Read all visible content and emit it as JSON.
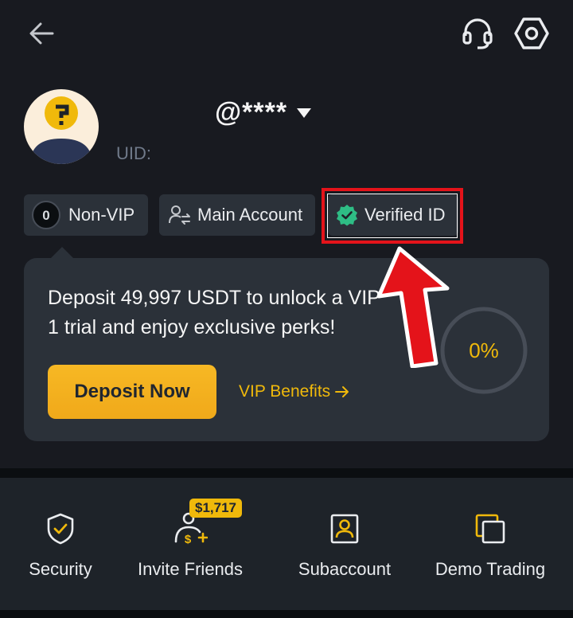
{
  "header": {
    "back_icon": "arrow-left-icon",
    "support_icon": "headset-icon",
    "settings_icon": "hexagon-settings-icon"
  },
  "profile": {
    "username": "@****",
    "uid_label": "UID:"
  },
  "tags": {
    "non_vip": "Non-VIP",
    "main_account": "Main Account",
    "verified_id": "Verified ID"
  },
  "promo": {
    "line1": "Deposit 49,997 USDT to unlock a VIP",
    "line2": "1 trial and enjoy exclusive perks!",
    "deposit_button": "Deposit Now",
    "vip_benefits": "VIP Benefits",
    "progress_text": "0%",
    "progress": 0
  },
  "quick_actions": [
    {
      "label": "Security",
      "icon": "shield-check-icon"
    },
    {
      "label": "Invite Friends",
      "icon": "person-dollar-icon",
      "badge": "$1,717"
    },
    {
      "label": "Subaccount",
      "icon": "person-card-icon"
    },
    {
      "label": "Demo Trading",
      "icon": "stacked-squares-icon"
    }
  ],
  "colors": {
    "background": "#181a20",
    "card": "#2b3139",
    "accent": "#f0b90b",
    "verified_green": "#2ebd85",
    "highlight_red": "#e4131a"
  }
}
